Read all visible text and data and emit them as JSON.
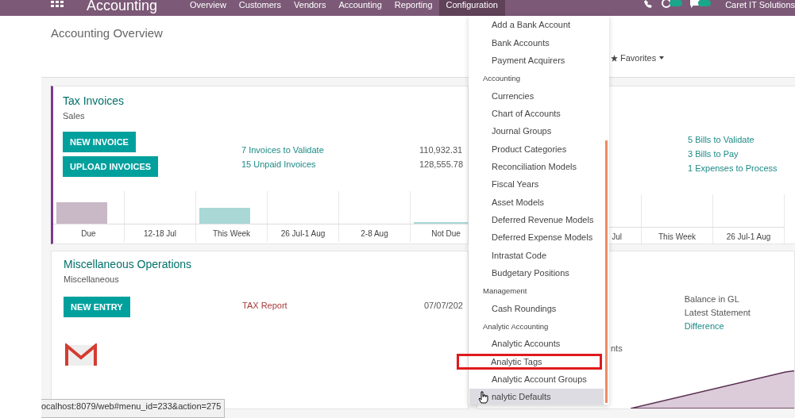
{
  "navbar": {
    "app_title": "Accounting",
    "menu": [
      {
        "label": "Overview",
        "selected": false
      },
      {
        "label": "Customers",
        "selected": false
      },
      {
        "label": "Vendors",
        "selected": false
      },
      {
        "label": "Accounting",
        "selected": false
      },
      {
        "label": "Reporting",
        "selected": false
      },
      {
        "label": "Configuration",
        "selected": true
      }
    ],
    "user": "Caret IT Solutions"
  },
  "header": {
    "title": "Accounting Overview",
    "favorites": "Favorites"
  },
  "cards": [
    {
      "kind": "sales",
      "title": "Tax Invoices",
      "subtitle": "Sales",
      "buttons": [
        "NEW INVOICE",
        "UPLOAD INVOICES"
      ],
      "links": [
        "7 Invoices to Validate",
        "15 Unpaid Invoices"
      ],
      "amounts": [
        "110,932.31",
        "128,555.78"
      ],
      "chart_labels": [
        "Due",
        "12-18 Jul",
        "This Week",
        "26 Jul-1 Aug",
        "2-8 Aug",
        "Not Due"
      ]
    },
    {
      "kind": "purchase",
      "links": [
        "5 Bills to Validate",
        "3 Bills to Pay",
        "1 Expenses to Process"
      ],
      "chart_labels": [
        "Jul",
        "This Week",
        "26 Jul-1 Aug"
      ]
    },
    {
      "kind": "general",
      "title": "Miscellaneous Operations",
      "subtitle": "Miscellaneous",
      "buttons": [
        "NEW ENTRY"
      ],
      "report": "TAX Report",
      "date": "07/07/202"
    },
    {
      "kind": "bank",
      "fragment": "nts",
      "lines": [
        {
          "kind": "label",
          "label": "Balance in GL"
        },
        {
          "kind": "label",
          "label": "Latest Statement"
        },
        {
          "kind": "link",
          "label": "Difference"
        }
      ]
    }
  ],
  "config_menu": [
    {
      "kind": "item",
      "label": "Add a Bank Account",
      "hovered": false,
      "highlighted": false
    },
    {
      "kind": "item",
      "label": "Bank Accounts",
      "hovered": false,
      "highlighted": false
    },
    {
      "kind": "item",
      "label": "Payment Acquirers",
      "hovered": false,
      "highlighted": false
    },
    {
      "kind": "header",
      "label": "Accounting"
    },
    {
      "kind": "item",
      "label": "Currencies",
      "hovered": false,
      "highlighted": false
    },
    {
      "kind": "item",
      "label": "Chart of Accounts",
      "hovered": false,
      "highlighted": false
    },
    {
      "kind": "item",
      "label": "Journal Groups",
      "hovered": false,
      "highlighted": false
    },
    {
      "kind": "item",
      "label": "Product Categories",
      "hovered": false,
      "highlighted": false
    },
    {
      "kind": "item",
      "label": "Reconciliation Models",
      "hovered": false,
      "highlighted": false
    },
    {
      "kind": "item",
      "label": "Fiscal Years",
      "hovered": false,
      "highlighted": false
    },
    {
      "kind": "item",
      "label": "Asset Models",
      "hovered": false,
      "highlighted": false
    },
    {
      "kind": "item",
      "label": "Deferred Revenue Models",
      "hovered": false,
      "highlighted": false
    },
    {
      "kind": "item",
      "label": "Deferred Expense Models",
      "hovered": false,
      "highlighted": false
    },
    {
      "kind": "item",
      "label": "Intrastat Code",
      "hovered": false,
      "highlighted": false
    },
    {
      "kind": "item",
      "label": "Budgetary Positions",
      "hovered": false,
      "highlighted": false
    },
    {
      "kind": "header",
      "label": "Management"
    },
    {
      "kind": "item",
      "label": "Cash Roundings",
      "hovered": false,
      "highlighted": false
    },
    {
      "kind": "header",
      "label": "Analytic Accounting"
    },
    {
      "kind": "item",
      "label": "Analytic Accounts",
      "hovered": false,
      "highlighted": false
    },
    {
      "kind": "item",
      "label": "Analytic Tags",
      "hovered": false,
      "highlighted": true
    },
    {
      "kind": "item",
      "label": "Analytic Account Groups",
      "hovered": false,
      "highlighted": false
    },
    {
      "kind": "item",
      "label": "nalytic Defaults",
      "hovered": true,
      "highlighted": false
    }
  ],
  "status_url": "ocalhost:8079/web#menu_id=233&action=275"
}
